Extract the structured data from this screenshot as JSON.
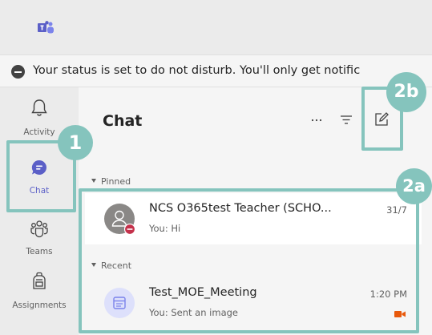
{
  "banner": {
    "text": "Your status is set to do not disturb. You'll only get notific"
  },
  "rail": {
    "items": [
      {
        "label": "Activity"
      },
      {
        "label": "Chat"
      },
      {
        "label": "Teams"
      },
      {
        "label": "Assignments"
      }
    ]
  },
  "chat": {
    "title": "Chat",
    "header_icons": [
      "more-options-icon",
      "filter-icon",
      "new-chat-icon"
    ],
    "sections": [
      {
        "label": "Pinned"
      },
      {
        "label": "Recent"
      }
    ],
    "items": [
      {
        "name": "NCS O365test Teacher (SCHO...",
        "preview": "You: Hi",
        "time": "31/7",
        "status": "do-not-disturb"
      },
      {
        "name": "Test_MOE_Meeting",
        "preview": "You: Sent an image",
        "time": "1:20 PM",
        "icon": "meeting-camera-icon"
      }
    ]
  },
  "annotations": {
    "badge_1": "1",
    "badge_2a": "2a",
    "badge_2b": "2b",
    "color": "#85C4BD"
  },
  "colors": {
    "accent": "#5B5FC7",
    "rail_bg": "#EBEBEB",
    "panel_bg": "#F5F5F5",
    "dnd_red": "#C4314B"
  }
}
